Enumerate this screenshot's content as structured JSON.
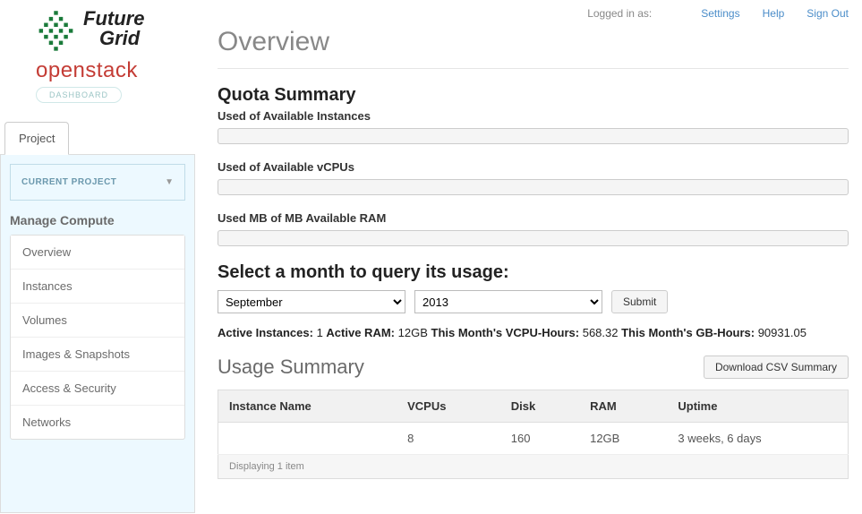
{
  "brand": {
    "line1": "Future",
    "line2": "Grid",
    "openstack": "openstack",
    "dashboard": "DASHBOARD"
  },
  "topbar": {
    "logged_in": "Logged in as:",
    "settings": "Settings",
    "help": "Help",
    "signout": "Sign Out"
  },
  "page_title": "Overview",
  "nav": {
    "tab": "Project",
    "current_project_label": "CURRENT PROJECT",
    "section": "Manage Compute",
    "items": [
      {
        "label": "Overview",
        "active": true
      },
      {
        "label": "Instances",
        "active": false
      },
      {
        "label": "Volumes",
        "active": false
      },
      {
        "label": "Images & Snapshots",
        "active": false
      },
      {
        "label": "Access & Security",
        "active": false
      },
      {
        "label": "Networks",
        "active": false
      }
    ]
  },
  "quota": {
    "heading": "Quota Summary",
    "instances_label": "Used of Available Instances",
    "vcpus_label": "Used of Available vCPUs",
    "ram_label": "Used MB of MB Available RAM"
  },
  "query": {
    "heading": "Select a month to query its usage:",
    "month": "September",
    "year": "2013",
    "submit": "Submit"
  },
  "stats": {
    "active_instances_label": "Active Instances:",
    "active_instances": "1",
    "active_ram_label": "Active RAM:",
    "active_ram": "12GB",
    "vcpu_hours_label": "This Month's VCPU-Hours:",
    "vcpu_hours": "568.32",
    "gb_hours_label": "This Month's GB-Hours:",
    "gb_hours": "90931.05"
  },
  "usage": {
    "title": "Usage Summary",
    "download": "Download CSV Summary",
    "cols": [
      "Instance Name",
      "VCPUs",
      "Disk",
      "RAM",
      "Uptime"
    ],
    "rows": [
      {
        "name": "",
        "vcpus": "8",
        "disk": "160",
        "ram": "12GB",
        "uptime": "3 weeks, 6 days"
      }
    ],
    "footer": "Displaying 1 item"
  }
}
